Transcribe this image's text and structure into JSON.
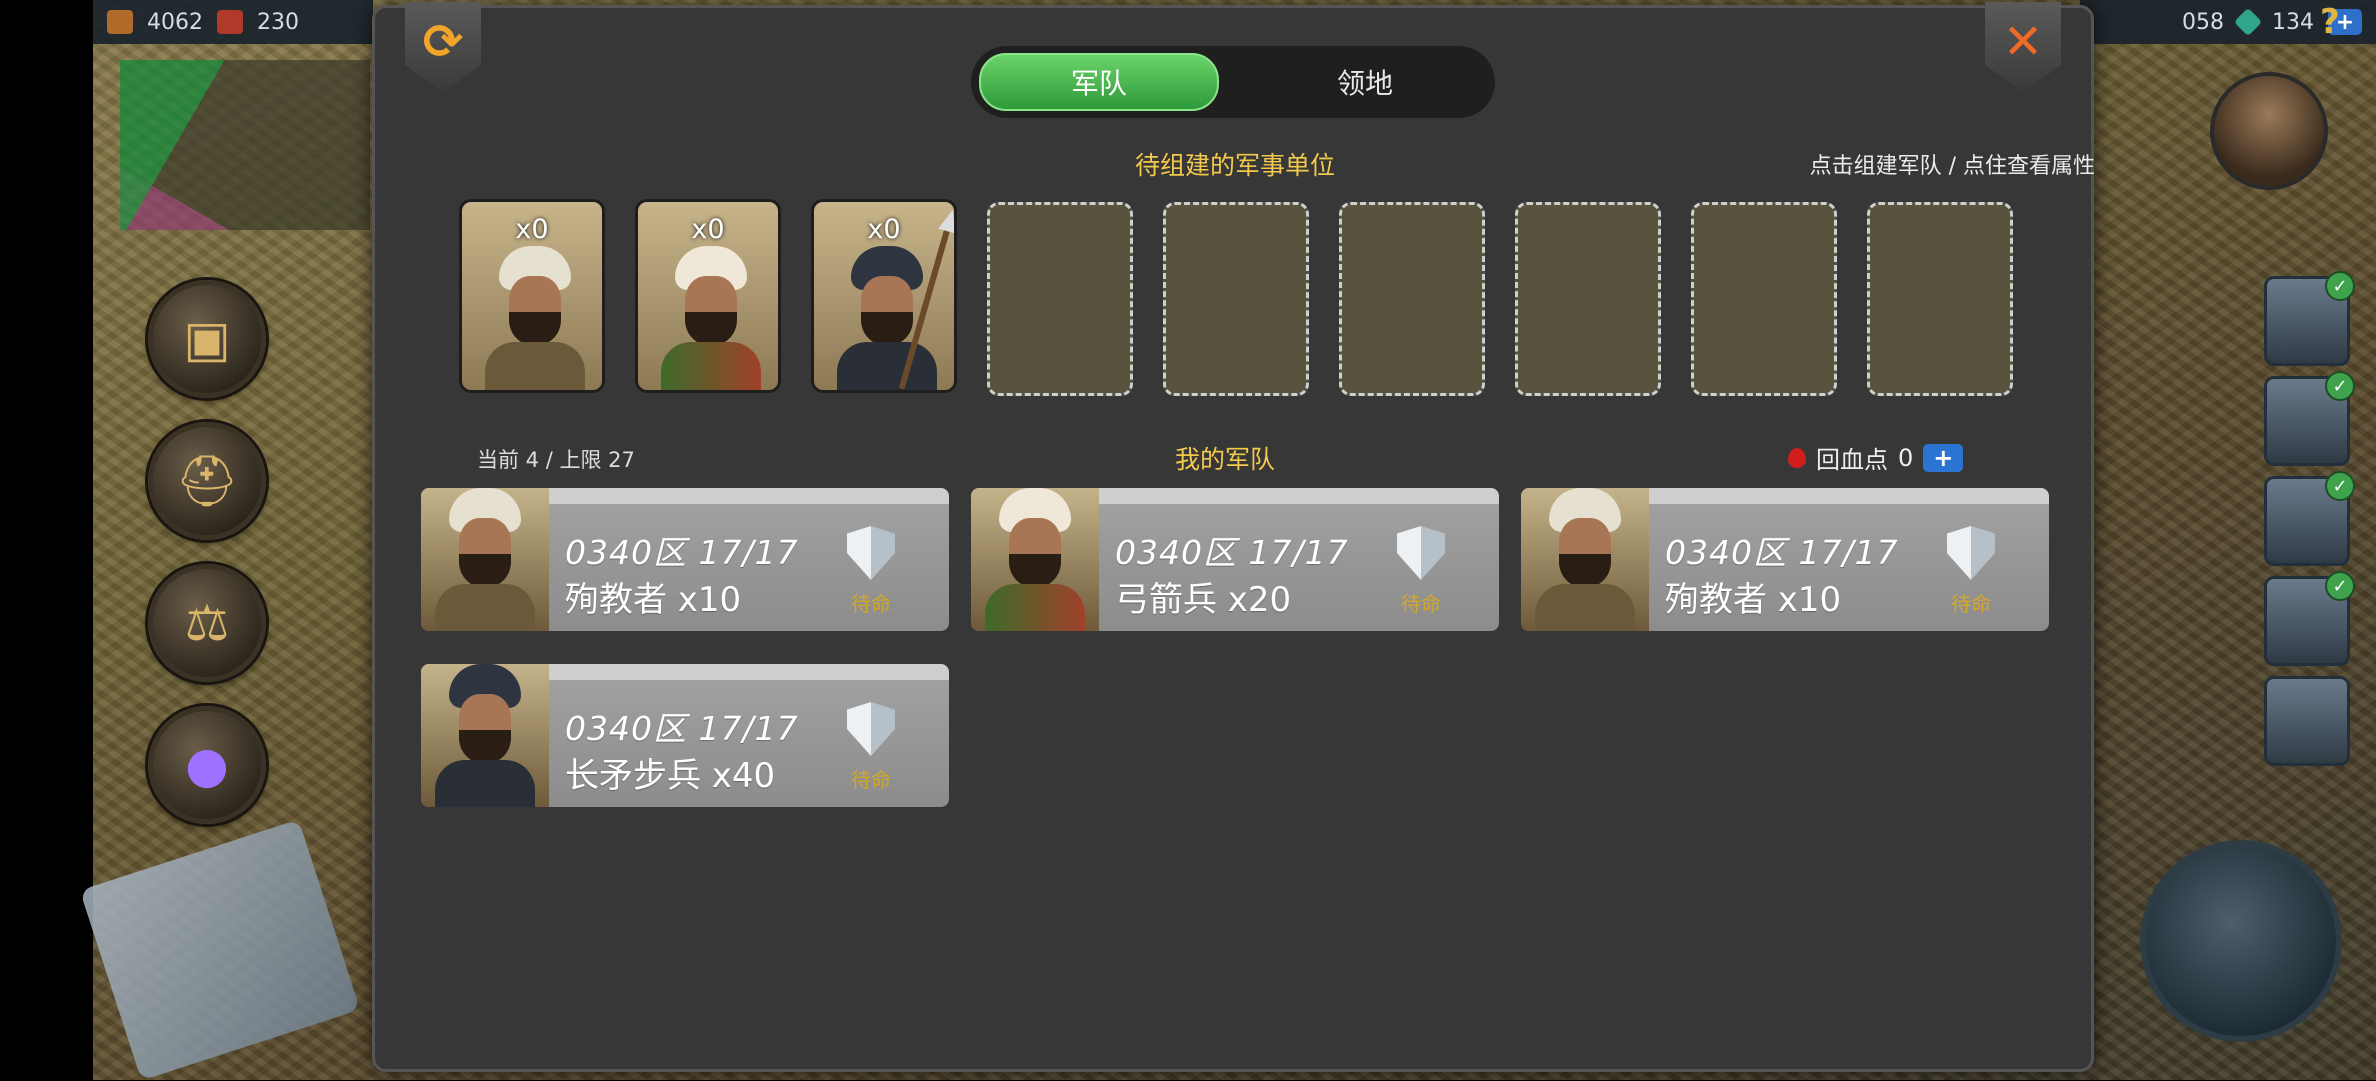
{
  "top_bar": {
    "left": [
      {
        "icon": "wood-crate-icon",
        "value": "4062",
        "color": "#b06a2a"
      },
      {
        "icon": "brick-icon",
        "value": "230",
        "color": "#b03a2a"
      }
    ],
    "right": [
      {
        "value": "058"
      },
      {
        "icon": "gem-icon",
        "value": "134",
        "color": "#2fa58a"
      }
    ],
    "add_label": "+",
    "help_label": "?"
  },
  "dialog": {
    "tabs": [
      {
        "label": "军队",
        "active": true
      },
      {
        "label": "领地",
        "active": false
      }
    ],
    "pending": {
      "title": "待组建的军事单位",
      "hint": "点击组建军队 / 点住查看属性",
      "units": [
        {
          "count": "x0",
          "type": "martyr"
        },
        {
          "count": "x0",
          "type": "archer"
        },
        {
          "count": "x0",
          "type": "spearman"
        }
      ],
      "empty_slots": 6
    },
    "army": {
      "current_text": "当前 4 / 上限 27",
      "title": "我的军队",
      "heal_label": "回血点",
      "heal_value": "0",
      "heal_add": "+",
      "cards": [
        {
          "line1": "0340区 17/17",
          "line2": "殉教者 x10",
          "status": "待命"
        },
        {
          "line1": "0340区 17/17",
          "line2": "弓箭兵 x20",
          "status": "待命"
        },
        {
          "line1": "0340区 17/17",
          "line2": "殉教者 x10",
          "status": "待命"
        },
        {
          "line1": "0340区 17/17",
          "line2": "长矛步兵 x40",
          "status": "待命"
        }
      ]
    },
    "refresh_glyph": "⟳",
    "close_glyph": "✕"
  }
}
